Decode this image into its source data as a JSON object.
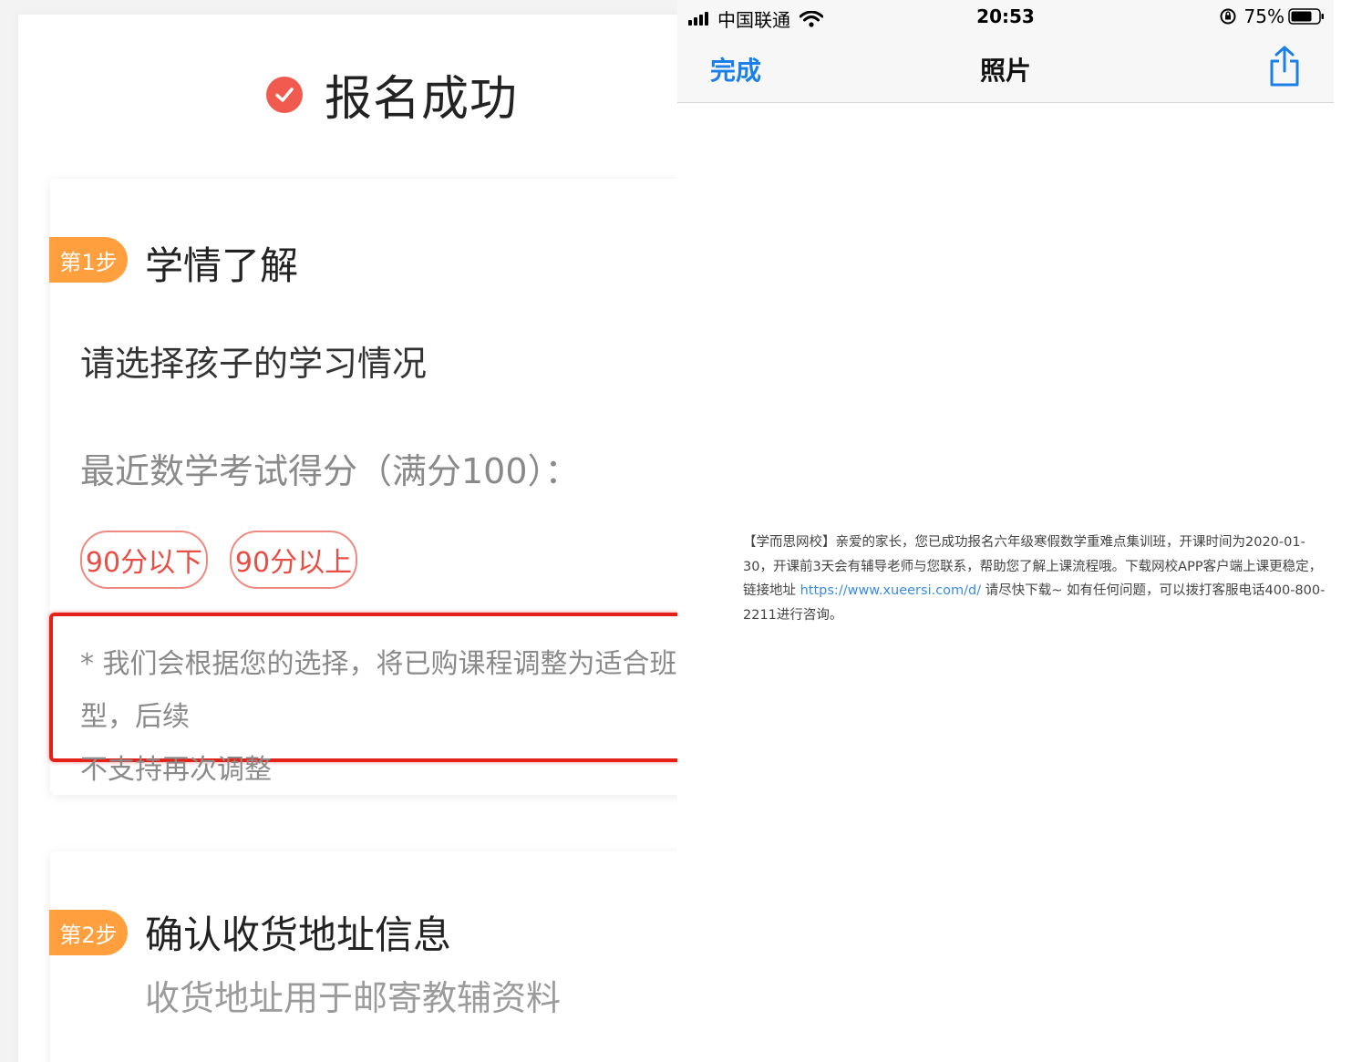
{
  "left": {
    "success_title": "报名成功",
    "step1": {
      "badge": "第1步",
      "title": "学情了解",
      "question": "请选择孩子的学习情况",
      "score_label": "最近数学考试得分（满分100）：",
      "options": [
        "90分以下",
        "90分以上"
      ],
      "note_line1": "* 我们会根据您的选择，将已购课程调整为适合班型，后续",
      "note_line2": "不支持再次调整"
    },
    "step2": {
      "badge": "第2步",
      "title": "确认收货地址信息",
      "subtitle": "收货地址用于邮寄教辅资料"
    },
    "accent_color": "#f05a4f",
    "badge_color": "#ff9f3d",
    "highlight_color": "#e32118"
  },
  "right": {
    "status_bar": {
      "carrier": "中国联通",
      "time": "20:53",
      "battery": "75%"
    },
    "nav": {
      "done_label": "完成",
      "title": "照片",
      "share_icon": "share-icon"
    },
    "sms": {
      "part1": "【学而思网校】亲爱的家长，您已成功报名六年级寒假数学重难点集训班，开课时间为2020-01-30，开课前3天会有辅导老师与您联系，帮助您了解上课流程哦。下载网校APP客户端上课更稳定，链接地址 ",
      "link": "https://www.xueersi.com/d/",
      "part2": " 请尽快下载~ 如有任何问题，可以拨打客服电话400-800-2211进行咨询。"
    },
    "link_color": "#1a7fe8"
  }
}
